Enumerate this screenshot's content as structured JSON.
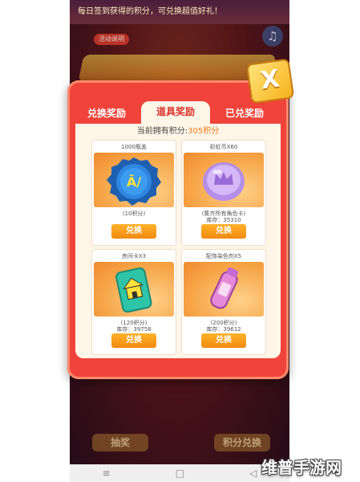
{
  "background": {
    "banner_text": "每日签到获得的积分，可兑换超值好礼！",
    "tag_text": "活动说明",
    "bottom_buttons": [
      "抽奖",
      "积分兑换"
    ]
  },
  "modal": {
    "close_label": "X",
    "tabs": [
      {
        "label": "兑换奖励",
        "active": false
      },
      {
        "label": "道具奖励",
        "active": true
      },
      {
        "label": "已兑奖励",
        "active": false
      }
    ],
    "points_prefix": "当前拥有积分:",
    "points_value": "305积分",
    "items": [
      {
        "title": "1000瓶盖",
        "cost": "(10积分)",
        "note": "",
        "stock": "",
        "button": "兑换"
      },
      {
        "title": "彩虹币X60",
        "cost": "",
        "note": "(集齐所有角色卡)",
        "stock": "库存：35310",
        "button": "兑换"
      },
      {
        "title": "房间卡X3",
        "cost": "(120积分)",
        "note": "",
        "stock": "库存：39758",
        "button": "兑换"
      },
      {
        "title": "配饰染色剂X5",
        "cost": "(200积分)",
        "note": "",
        "stock": "库存：39612",
        "button": "兑换"
      }
    ]
  },
  "system_nav": {
    "back": "≡",
    "home": "□",
    "recent": "◁"
  },
  "watermark": "维普手游网",
  "colors": {
    "modal_red": "#f0433a",
    "panel_bg": "#fff6e8",
    "button_orange": "#f08a10",
    "points_orange": "#f07a1a"
  }
}
